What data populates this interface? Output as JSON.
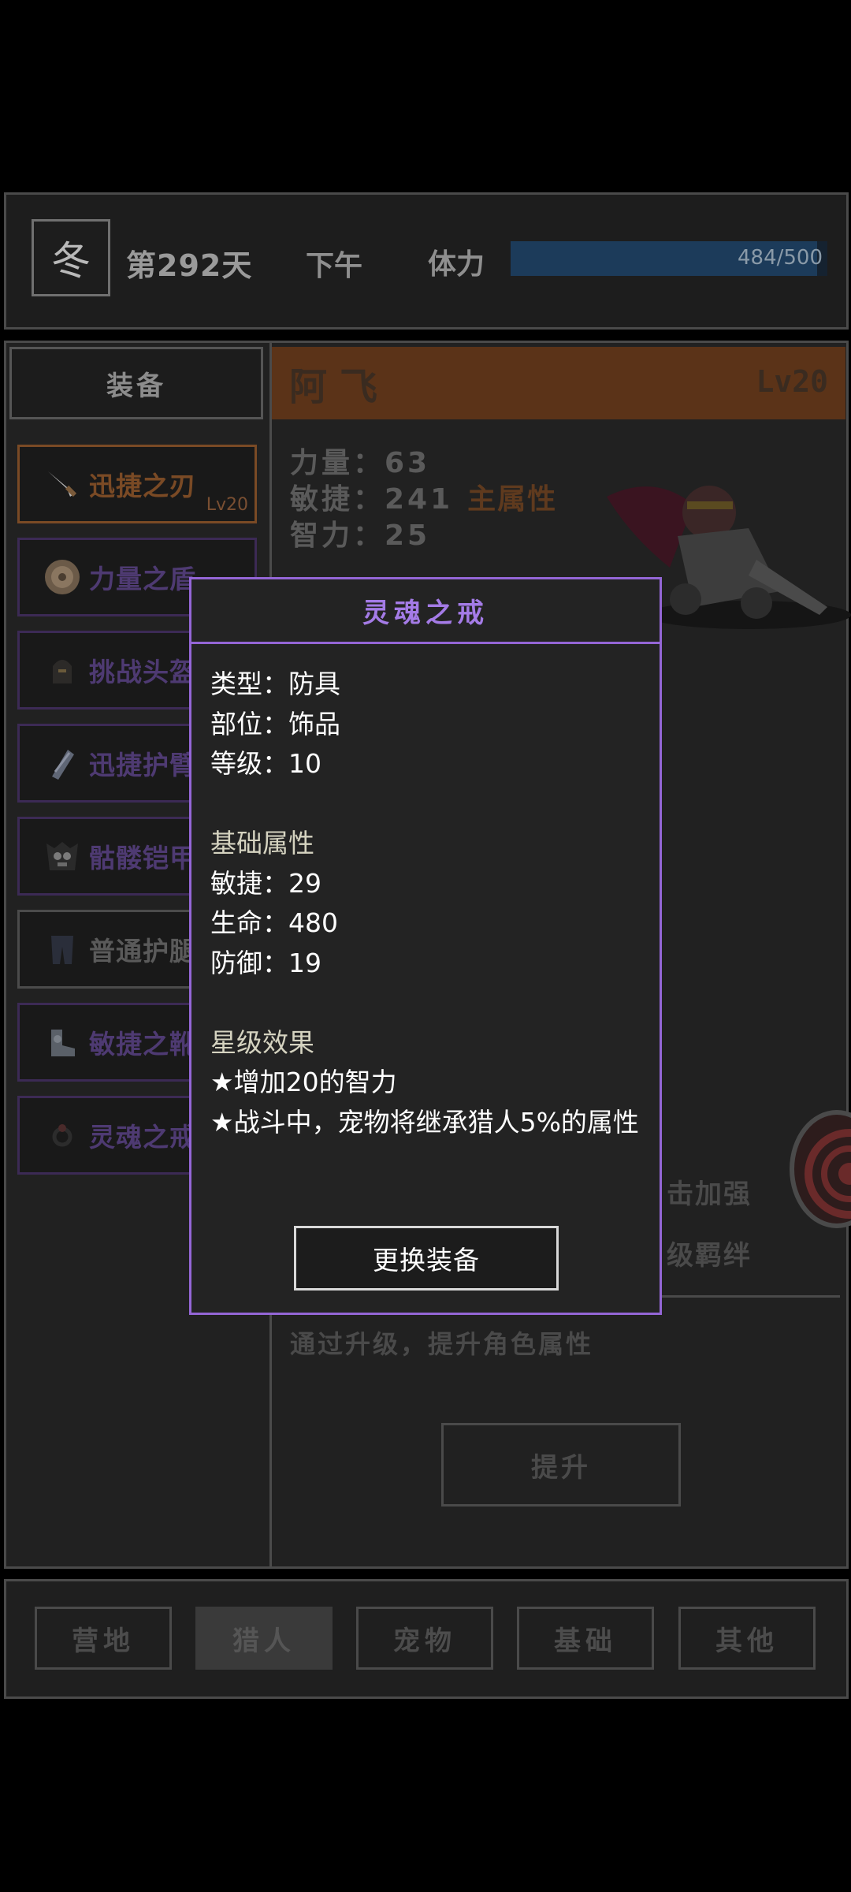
{
  "status": {
    "season": "冬",
    "day": "第292天",
    "time_of_day": "下午",
    "stamina_label": "体力",
    "stamina_value": "484/500",
    "stamina_fraction": 0.968
  },
  "equipment_panel": {
    "title": "装备",
    "slots": [
      {
        "name": "迅捷之刃",
        "level": "Lv20",
        "icon": "dagger-icon"
      },
      {
        "name": "力量之盾",
        "icon": "shield-icon"
      },
      {
        "name": "挑战头盔",
        "icon": "helmet-icon"
      },
      {
        "name": "迅捷护臂",
        "icon": "bracer-icon"
      },
      {
        "name": "骷髅铠甲",
        "icon": "skull-armor-icon"
      },
      {
        "name": "普通护腿",
        "icon": "leggings-icon"
      },
      {
        "name": "敏捷之靴",
        "icon": "boots-icon"
      },
      {
        "name": "灵魂之戒",
        "icon": "ring-icon"
      }
    ]
  },
  "hero": {
    "name": "阿飞",
    "level": "Lv20",
    "stats": {
      "strength": "力量：63",
      "agility": "敏捷：241",
      "main_attr": "主属性",
      "intelligence": "智力：25"
    },
    "skill_line_1": "击加强",
    "skill_line_2": "级羁绊",
    "upgrade_hint": "通过升级，提升角色属性",
    "upgrade_button": "提升"
  },
  "item_modal": {
    "title": "灵魂之戒",
    "type_line": "类型：防具",
    "slot_line": "部位：饰品",
    "level_line": "等级：10",
    "base_header": "基础属性",
    "base_stats": [
      "敏捷：29",
      "生命：480",
      "防御：19"
    ],
    "star_header": "星级效果",
    "star_effects": [
      "★增加20的智力",
      "★战斗中，宠物将继承猎人5%的属性"
    ],
    "button": "更换装备"
  },
  "bottom_nav": {
    "tabs": [
      "营地",
      "猎人",
      "宠物",
      "基础",
      "其他"
    ],
    "active": "猎人"
  },
  "colors": {
    "modal_border": "#9466d6",
    "selected_slot": "#7a4a25",
    "hero_header": "#5b3318"
  }
}
